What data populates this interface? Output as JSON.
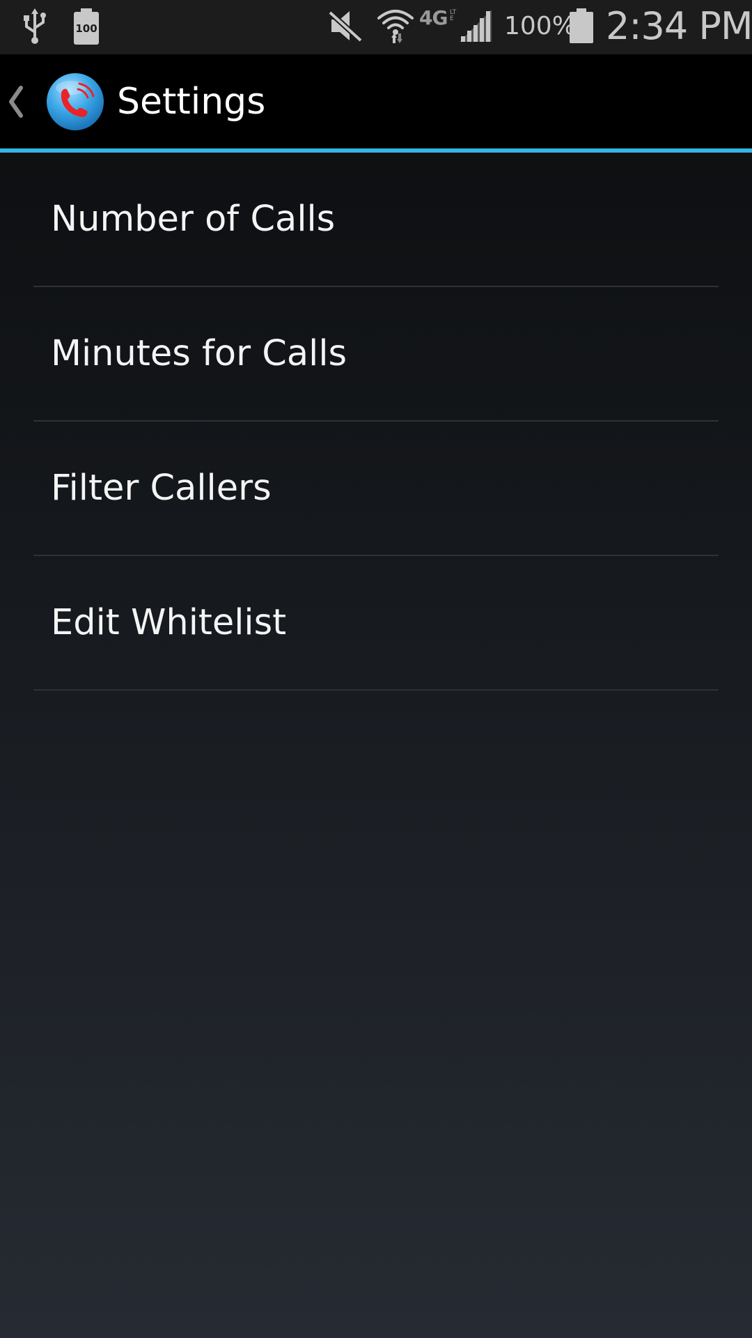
{
  "status_bar": {
    "battery_icon_level": "100",
    "battery_percent": "100%",
    "network_type": "4G",
    "network_subtype": "LTE",
    "time": "2:34 PM",
    "icons": [
      "usb-icon",
      "battery-notification-icon",
      "mute-icon",
      "wifi-icon",
      "network-4g-lte-icon",
      "signal-icon",
      "battery-icon"
    ]
  },
  "action_bar": {
    "title": "Settings",
    "accent_color": "#33b5e5",
    "app_icon": "phone-icon"
  },
  "settings": {
    "items": [
      {
        "label": "Number of Calls"
      },
      {
        "label": "Minutes for Calls"
      },
      {
        "label": "Filter Callers"
      },
      {
        "label": "Edit Whitelist"
      }
    ]
  }
}
